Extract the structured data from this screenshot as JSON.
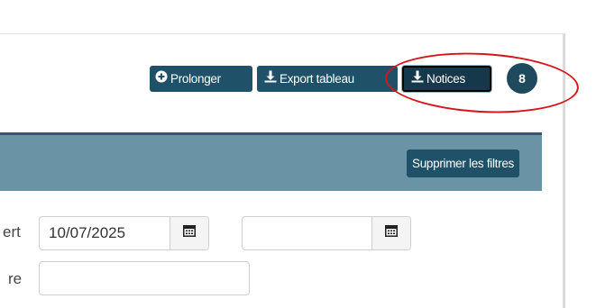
{
  "toolbar": {
    "prolonger_label": "Prolonger",
    "export_label": "Export tableau",
    "notices_label": "Notices",
    "count": "8"
  },
  "filters": {
    "clear_label": "Supprimer les filtres",
    "row1_label_fragment": "ert",
    "row2_label_fragment": "re",
    "date_from_value": "10/07/2025",
    "date_to_value": "",
    "text_value": ""
  },
  "icons": {
    "prolonger": "plus-circle-icon",
    "export": "download-icon",
    "notices": "download-icon",
    "calendar": "calendar-icon"
  },
  "colors": {
    "button_bg": "#1f5268",
    "filter_header_bg": "#6b93a6",
    "highlight": "#d8141b"
  }
}
